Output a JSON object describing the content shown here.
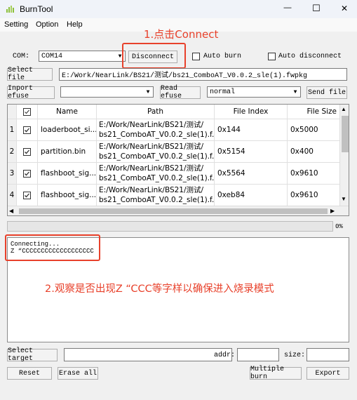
{
  "window": {
    "title": "BurnTool",
    "minimize": "—",
    "maximize": "☐",
    "close": "✕"
  },
  "menu": {
    "items": [
      "Setting",
      "Option",
      "Help"
    ]
  },
  "annotations": {
    "step1": "1.点击Connect",
    "step2": "2.观察是否出现Z “CCC等字样以确保进入烧录模式"
  },
  "toolbar": {
    "com_label": "COM:",
    "com_value": "COM14",
    "connect_button": "Disconnect",
    "auto_burn": "Auto burn",
    "auto_disconnect": "Auto disconnect",
    "select_file_button": "Select file",
    "file_path": "E:/Work/NearLink/BS21/测试/bs21_ComboAT_V0.0.2_sle(1).fwpkg",
    "import_efuse_button": "Inport efuse",
    "efuse_value": "",
    "read_efuse_button": "Read efuse",
    "mode_value": "normal",
    "send_file_button": "Send file"
  },
  "table": {
    "columns": [
      "",
      "Name",
      "Path",
      "File Index",
      "File Size"
    ],
    "rows": [
      {
        "num": "1",
        "checked": true,
        "name": "loaderboot_si...",
        "path1": "E:/Work/NearLink/BS21/测试/",
        "path2": "bs21_ComboAT_V0.0.2_sle(1).f...",
        "index": "0x144",
        "size": "0x5000"
      },
      {
        "num": "2",
        "checked": true,
        "name": "partition.bin",
        "path1": "E:/Work/NearLink/BS21/测试/",
        "path2": "bs21_ComboAT_V0.0.2_sle(1).f...",
        "index": "0x5154",
        "size": "0x400"
      },
      {
        "num": "3",
        "checked": true,
        "name": "flashboot_sig...",
        "path1": "E:/Work/NearLink/BS21/测试/",
        "path2": "bs21_ComboAT_V0.0.2_sle(1).f...",
        "index": "0x5564",
        "size": "0x9610"
      },
      {
        "num": "4",
        "checked": true,
        "name": "flashboot_sig...",
        "path1": "E:/Work/NearLink/BS21/测试/",
        "path2": "bs21_ComboAT_V0.0.2_sle(1).f...",
        "index": "0xeb84",
        "size": "0x9610"
      }
    ]
  },
  "progress": {
    "percent_label": "0%",
    "value": 0
  },
  "log": {
    "line1": "Connecting...",
    "line2": "Z “CCCCCCCCCCCCCCCCCCC"
  },
  "bottom": {
    "select_target_button": "Select target",
    "target_value": "",
    "addr_label": "addr:",
    "addr_value": "",
    "size_label": "size:",
    "size_value": "",
    "reset_button": "Reset",
    "erase_all_button": "Erase all",
    "multiple_burn_button": "Multiple burn",
    "export_button": "Export"
  },
  "colors": {
    "annotation": "#e8412b",
    "window_bg": "#f0f0f0"
  }
}
